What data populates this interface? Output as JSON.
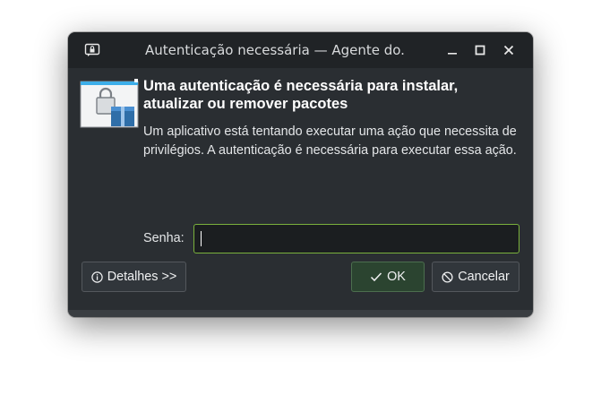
{
  "window": {
    "title": "Autenticação necessária — Agente do...",
    "app_icon": "lock-window-icon",
    "controls": {
      "minimize_icon": "minimize-icon",
      "maximize_icon": "maximize-icon",
      "close_icon": "close-icon"
    }
  },
  "dialog": {
    "icon": "locked-package-icon",
    "heading": "Uma autenticação é necessária para instalar, atualizar ou remover pacotes",
    "description": "Um aplicativo está tentando executar uma ação que necessita de privilégios. A autenticação é necessária para executar essa ação.",
    "password_label": "Senha:",
    "password_value": ""
  },
  "buttons": {
    "details_label": "Detalhes >>",
    "details_icon": "info-icon",
    "ok_label": "OK",
    "ok_icon": "check-icon",
    "cancel_label": "Cancelar",
    "cancel_icon": "cancel-icon"
  },
  "colors": {
    "window_bg": "#2a2e32",
    "titlebar_bg": "#202326",
    "focus_accent": "#7ab13c",
    "ok_button_bg": "#2b4430"
  }
}
